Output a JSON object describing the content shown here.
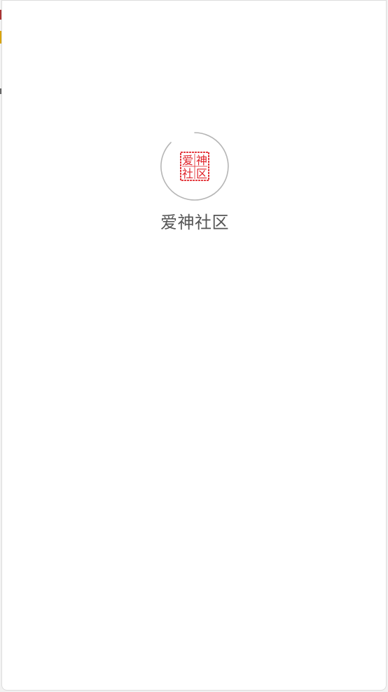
{
  "app": {
    "title": "爱神社区"
  },
  "logo": {
    "seal_chars": [
      "爱",
      "神",
      "社",
      "区"
    ],
    "seal_color": "#e0242a",
    "icon": "seal-logo"
  },
  "spinner": {
    "color": "#b5b5b5",
    "icon": "loading-ring"
  },
  "colors": {
    "background": "#ffffff",
    "title_text": "#555555"
  }
}
